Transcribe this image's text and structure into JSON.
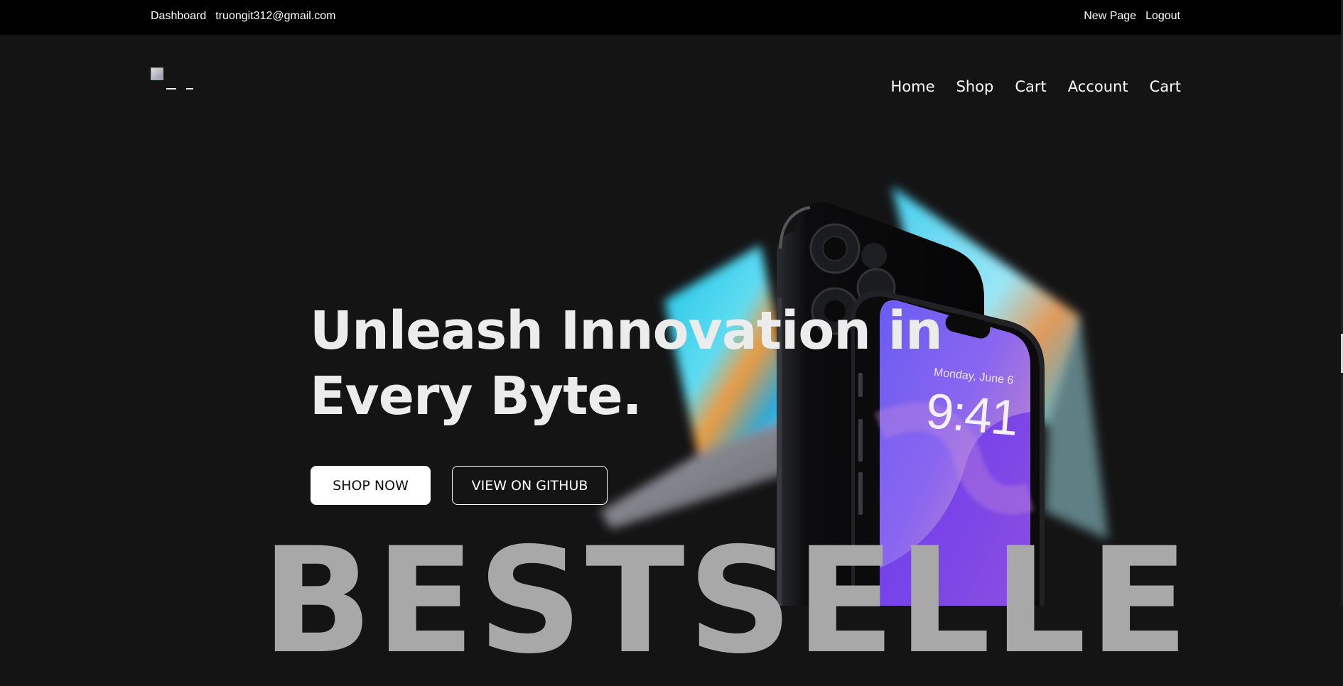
{
  "topbar": {
    "dashboard": "Dashboard",
    "email": "truongit312@gmail.com",
    "new_page": "New Page",
    "logout": "Logout"
  },
  "nav": {
    "items": [
      "Home",
      "Shop",
      "Cart",
      "Account",
      "Cart"
    ]
  },
  "hero": {
    "headline_line1": "Unleash Innovation in",
    "headline_line2": "Every Byte.",
    "shop_now": "SHOP NOW",
    "view_github": "VIEW ON GITHUB",
    "background_word": "BESTSELLE",
    "phone_date": "Monday, June 6",
    "phone_time": "9:41"
  },
  "colors": {
    "background": "#141415",
    "topbar": "#000000",
    "accent_phone": "#6b4de6",
    "background_word": "#a8a8a8"
  }
}
